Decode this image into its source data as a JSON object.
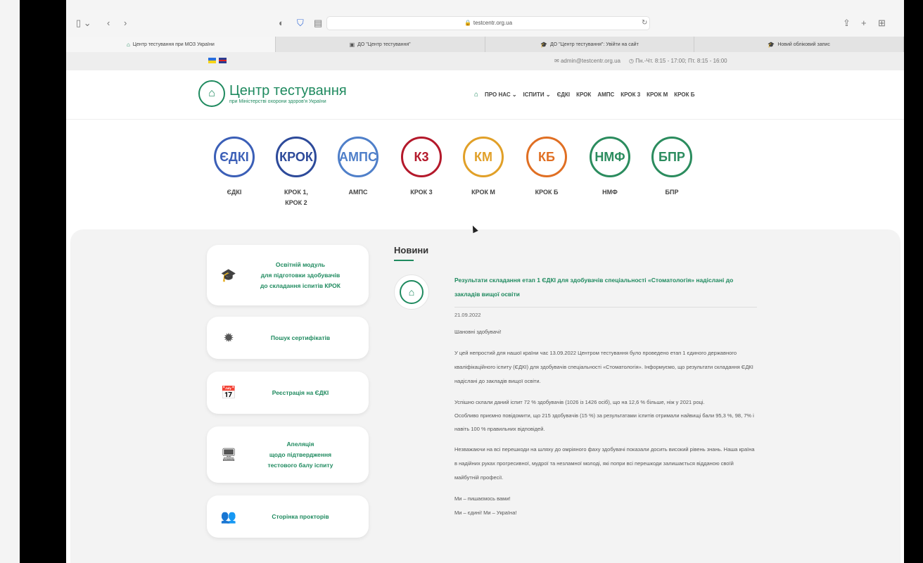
{
  "browser": {
    "url": "testcentr.org.ua",
    "tabs": [
      "Центр тестування при МОЗ України",
      "ДО \"Центр тестування\"",
      "ДО \"Центр тестування\": Увійти на сайт",
      "Новий обліковий запис"
    ]
  },
  "infobar": {
    "email": "admin@testcentr.org.ua",
    "hours": "Пн.-Чт. 8:15 - 17:00; Пт. 8:15 - 16:00"
  },
  "header": {
    "logo_title": "Центр тестування",
    "logo_subtitle": "при Міністерстві охорони здоров'я України",
    "nav": [
      "ПРО НАС ⌄",
      "ІСПИТИ ⌄",
      "ЄДКІ",
      "КРОК",
      "АМПС",
      "КРОК 3",
      "КРОК М",
      "КРОК Б"
    ]
  },
  "exams": [
    {
      "abbr": "ЄДКІ",
      "label": "ЄДКІ",
      "color": "#3b5fb7"
    },
    {
      "abbr": "КРОК",
      "label": "КРОК 1,\nКРОК 2",
      "color": "#2d4a9a"
    },
    {
      "abbr": "АМПС",
      "label": "АМПС",
      "color": "#4f7fc9"
    },
    {
      "abbr": "К3",
      "label": "КРОК 3",
      "color": "#b4192b"
    },
    {
      "abbr": "КМ",
      "label": "КРОК М",
      "color": "#e1a028"
    },
    {
      "abbr": "КБ",
      "label": "КРОК Б",
      "color": "#e06f23"
    },
    {
      "abbr": "НМФ",
      "label": "НМФ",
      "color": "#2b8c5e"
    },
    {
      "abbr": "БПР",
      "label": "БПР",
      "color": "#2b8c5e"
    }
  ],
  "cards": [
    {
      "icon": "graduation-cap-icon",
      "glyph": "🎓",
      "text": "Освітній модуль\nдля підготовки здобувачів\nдо складання іспитів КРОК"
    },
    {
      "icon": "certificate-icon",
      "glyph": "✹",
      "text": "Пошук сертифікатів"
    },
    {
      "icon": "calendar-check-icon",
      "glyph": "📅",
      "text": "Реєстрація на ЄДКІ"
    },
    {
      "icon": "monitor-icon",
      "glyph": "🖥",
      "text": "Апеляція\nщодо підтвердження\nтестового балу іспиту"
    },
    {
      "icon": "users-icon",
      "glyph": "👥",
      "text": "Сторінка прокторів"
    }
  ],
  "news": {
    "section_title": "Новини",
    "headline": "Результати складання етап 1 ЄДКІ для здобувачів спеціальності «Стоматологія» надіслані до закладів вищої освіти",
    "date": "21.09.2022",
    "paragraphs": [
      "Шановні здобувачі!",
      "У цей непростий для нашої країни час 13.09.2022 Центром тестування було проведено етап 1 єдиного державного кваліфікаційного іспиту (ЄДКІ) для здобувачів спеціальності «Стоматологія». Інформуємо, що результати складання ЄДКІ надіслані до закладів вищої освіти.",
      "Успішно склали даний іспит 72 % здобувачів (1026 із 1426 осіб), що на 12,6 % більше, ніж у 2021 році.\nОсобливо приємно повідомити, що 215 здобувачів (15 %) за результатами іспитів отримали найвищі бали 95,3 %, 98, 7% і навіть 100 % правильних відповідей.",
      "Незважаючи на всі перешкоди на шляху до омріяного фаху здобувачі показали досить високий рівень знань. Наша країна в надійних руках прогресивної, мудрої та незламної молоді, які попри всі перешкоди залишається відданою своїй майбутній професії.",
      "Ми – пишаємось вами!\nМи – єдині! Ми – Україна!"
    ]
  }
}
